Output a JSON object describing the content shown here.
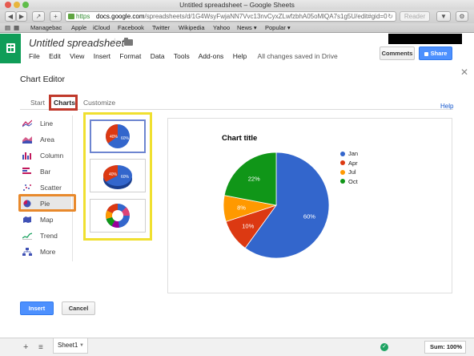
{
  "browser": {
    "window_title": "Untitled spreadsheet – Google Sheets",
    "url_scheme": "https",
    "url_domain": "docs.google.com",
    "url_path": "/spreadsheets/d/1G4WsyFwjaNN7Vvc13nvCyxZLwfzbhA05oMlQA7s1g5U/edit#gid=0",
    "reader_label": "Reader",
    "bookmarks": [
      "Managebac",
      "Apple",
      "iCloud",
      "Facebook",
      "Twitter",
      "Wikipedia",
      "Yahoo",
      "News ▾",
      "Popular ▾"
    ]
  },
  "sheets": {
    "doc_title": "Untitled spreadsheet",
    "menu": [
      "File",
      "Edit",
      "View",
      "Insert",
      "Format",
      "Data",
      "Tools",
      "Add-ons",
      "Help"
    ],
    "save_status": "All changes saved in Drive",
    "comments_label": "Comments",
    "share_label": "Share"
  },
  "dialog": {
    "title": "Chart Editor",
    "tabs": [
      "Start",
      "Charts",
      "Customize"
    ],
    "active_tab": "Charts",
    "help_label": "Help",
    "chart_types": [
      "Line",
      "Area",
      "Column",
      "Bar",
      "Scatter",
      "Pie",
      "Map",
      "Trend",
      "More"
    ],
    "selected_type": "Pie",
    "insert_label": "Insert",
    "cancel_label": "Cancel"
  },
  "thumbnails": {
    "pie_labels": [
      "40%",
      "60%"
    ],
    "pie3d_labels": [
      "40%",
      "60%"
    ]
  },
  "chart_data": {
    "type": "pie",
    "title": "Chart title",
    "categories": [
      "Jan",
      "Apr",
      "Jul",
      "Oct"
    ],
    "values": [
      60,
      10,
      8,
      22
    ],
    "labels": [
      "60%",
      "10%",
      "8%",
      "22%"
    ],
    "colors": [
      "#3366cc",
      "#dc3912",
      "#ff9900",
      "#109618"
    ],
    "legend_position": "right"
  },
  "footer": {
    "sheet_name": "Sheet1",
    "sum_label": "Sum: 100%"
  },
  "colors": {
    "sheets_green": "#0f9d58",
    "highlight_red": "#c0392b",
    "highlight_orange": "#e8892c",
    "highlight_yellow": "#f0e030",
    "primary_blue": "#4d90fe"
  }
}
